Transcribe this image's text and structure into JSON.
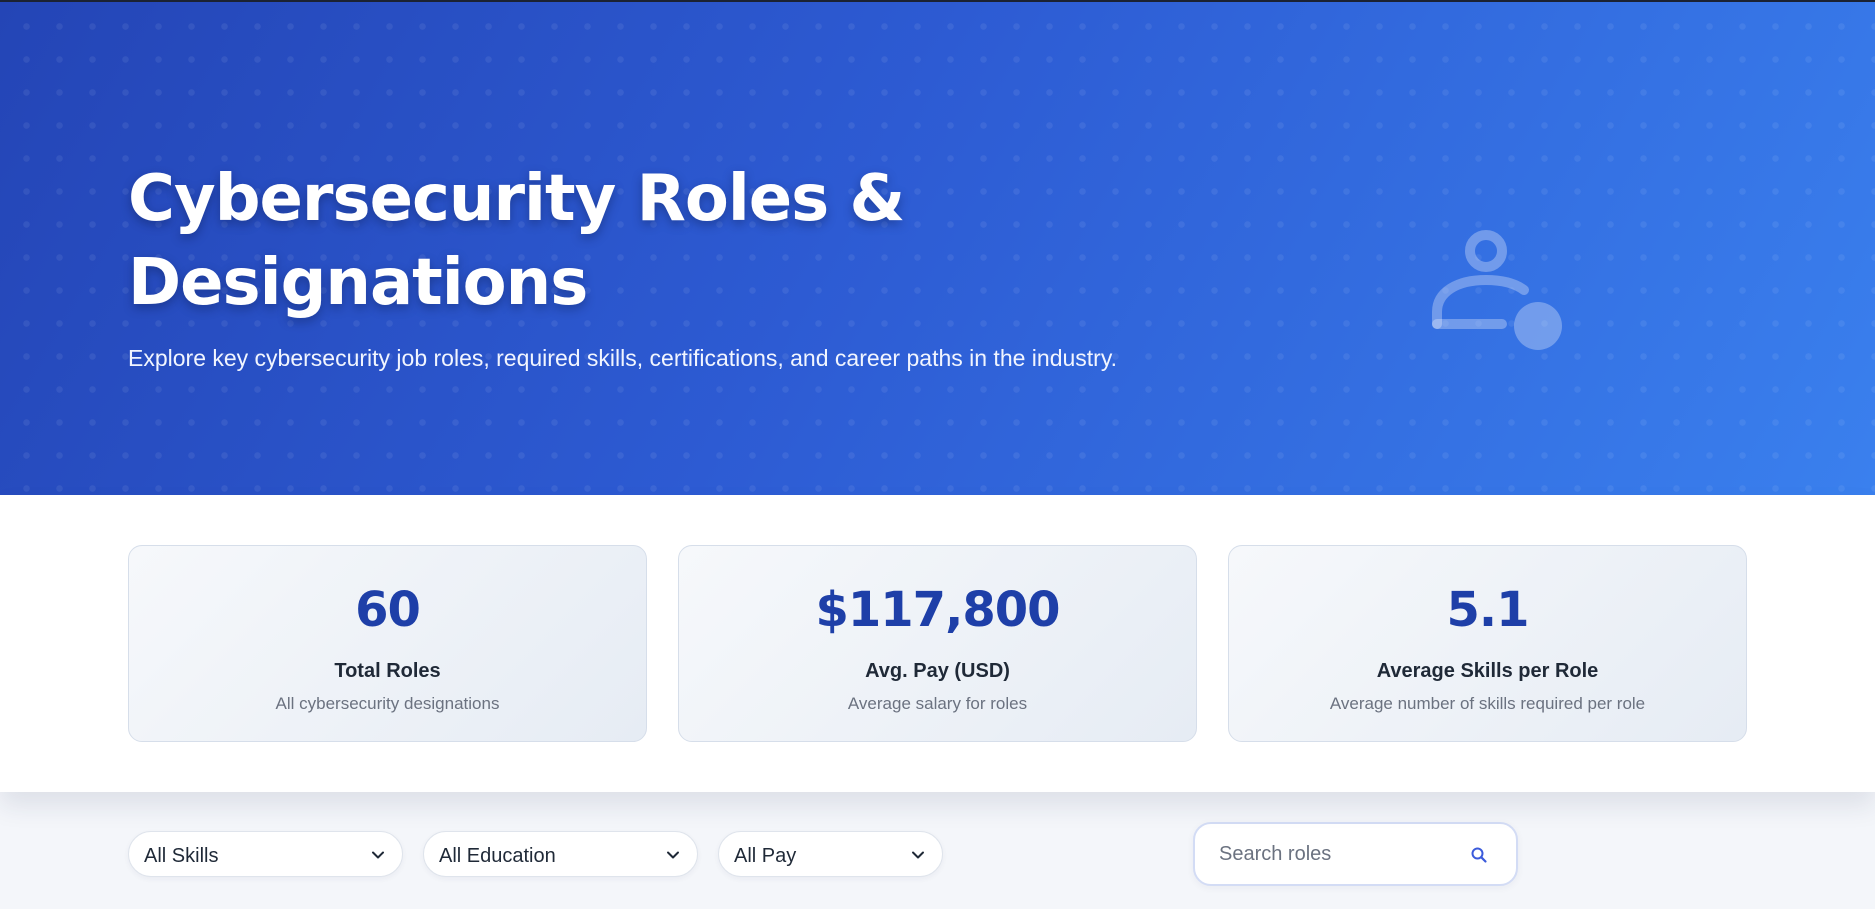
{
  "hero": {
    "title": "Cybersecurity Roles & Designations",
    "subtitle": "Explore key cybersecurity job roles, required skills, certifications, and career paths in the industry.",
    "icon": "user-badge-icon"
  },
  "stats": [
    {
      "value": "60",
      "label": "Total Roles",
      "description": "All cybersecurity designations"
    },
    {
      "value": "$117,800",
      "label": "Avg. Pay (USD)",
      "description": "Average salary for roles"
    },
    {
      "value": "5.1",
      "label": "Average Skills per Role",
      "description": "Average number of skills required per role"
    }
  ],
  "filters": {
    "skills": {
      "selected": "All Skills"
    },
    "education": {
      "selected": "All Education"
    },
    "pay": {
      "selected": "All Pay"
    }
  },
  "search": {
    "placeholder": "Search roles",
    "value": "",
    "icon": "search-icon"
  },
  "colors": {
    "hero_start": "#2445b6",
    "hero_end": "#3a80ee",
    "stat_value": "#1e3fa8"
  }
}
